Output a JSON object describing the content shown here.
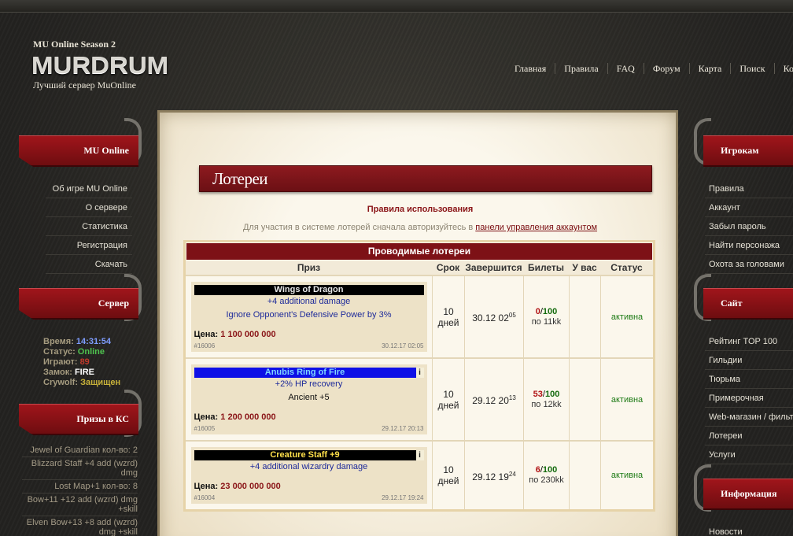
{
  "header": {
    "season": "MU Online Season 2",
    "logo": "MURDRUM",
    "tagline": "Лучший сервер MuOnline",
    "nav": [
      "Главная",
      "Правила",
      "FAQ",
      "Форум",
      "Карта",
      "Поиск",
      "Конта"
    ]
  },
  "left": {
    "block1_title": "MU Online",
    "block1_items": [
      "Об игре MU Online",
      "О сервере",
      "Статистика",
      "Регистрация",
      "Скачать"
    ],
    "block2_title": "Сервер",
    "server": {
      "time_label": "Время:",
      "time_value": "14:31:54",
      "status_label": "Статус:",
      "status_value": "Online",
      "players_label": "Играют:",
      "players_value": "89",
      "castle_label": "Замок:",
      "castle_value": "FIRE",
      "crywolf_label": "Crywolf:",
      "crywolf_value": "Защищен"
    },
    "block3_title": "Призы в КС",
    "prizes": [
      "Jewel of Guardian кол-во: 2",
      "Blizzard Staff +4 add (wzrd) dmg",
      "Lost Map+1 кол-во: 8",
      "Bow+11 +12 add (wzrd) dmg +skill",
      "Elven Bow+13 +8 add (wzrd) dmg +skill"
    ]
  },
  "right": {
    "block1_title": "Игрокам",
    "block1_items": [
      "Правила",
      "Аккаунт",
      "Забыл пароль",
      "Найти персонажа",
      "Охота за головами"
    ],
    "block2_title": "Сайт",
    "block2_items": [
      "Рейтинг TOP 100",
      "Гильдии",
      "Тюрьма",
      "Примерочная",
      "Web-магазин / фильт",
      "Лотереи",
      "Услуги"
    ],
    "block3_title": "Информация",
    "block3_items": [
      "Новости"
    ]
  },
  "main": {
    "title": "Лотереи",
    "rules_link": "Правила использования",
    "notice_text": "Для участия в системе лотерей сначала авторизуйтесь в",
    "notice_link": "панели управления аккаунтом",
    "table_caption": "Проводимые лотереи",
    "columns": [
      "Приз",
      "Срок",
      "Завершится",
      "Билеты",
      "У вас",
      "Статус"
    ],
    "rows": [
      {
        "name": "Wings of Dragon",
        "name_style": "black",
        "info_mark": "",
        "options": [
          "+4 additional damage",
          "Ignore Opponent's Defensive Power by 3%"
        ],
        "price_label": "Цена:",
        "price": "1 100 000 000",
        "id": "#16006",
        "created": "30.12.17 02:05",
        "term": "10 дней",
        "end_main": "30.12 02",
        "end_sup": "05",
        "sold": "0",
        "total": "100",
        "per": "по 11kk",
        "you": "",
        "status": "активна"
      },
      {
        "name": "Anubis Ring of Fire",
        "name_style": "blue",
        "info_mark": "i",
        "options": [
          "+2% HP recovery",
          "Ancient +5"
        ],
        "price_label": "Цена:",
        "price": "1 200 000 000",
        "id": "#16005",
        "created": "29.12.17 20:13",
        "term": "10 дней",
        "end_main": "29.12 20",
        "end_sup": "13",
        "sold": "53",
        "total": "100",
        "per": "по 12kk",
        "you": "",
        "status": "активна"
      },
      {
        "name": "Creature Staff +9",
        "name_style": "black",
        "info_mark": "i",
        "options": [
          "+4 additional wizardry damage"
        ],
        "price_label": "Цена:",
        "price": "23 000 000 000",
        "id": "#16004",
        "created": "29.12.17 19:24",
        "term": "10 дней",
        "end_main": "29.12 19",
        "end_sup": "24",
        "sold": "6",
        "total": "100",
        "per": "по 230kk",
        "you": "",
        "status": "активна"
      }
    ]
  },
  "colors": {
    "accent_red": "#8a1417",
    "status_green": "#1c7a14",
    "time_blue": "#7e9dff",
    "online_green": "#4fc24f"
  }
}
